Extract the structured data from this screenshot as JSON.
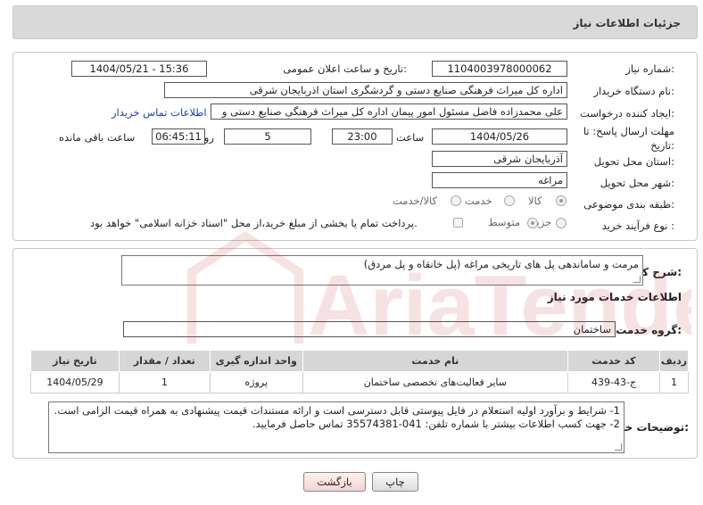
{
  "header": {
    "title": "جزئیات اطلاعات نیاز"
  },
  "form": {
    "need_number_label": "شماره نیاز:",
    "need_number": "1104003978000062",
    "announce_label": "تاریخ و ساعت اعلان عمومی:",
    "announce_value": "1404/05/21 - 15:36",
    "buyer_label": "نام دستگاه خریدار:",
    "buyer_value": "اداره کل میراث فرهنگی  صنایع دستی و گردشگری استان اذربایجان شرقی",
    "creator_label": "ایجاد کننده درخواست:",
    "creator_value": "علی محمدزاده فاضل مسئول امور پیمان اداره کل میراث فرهنگی  صنایع دستی و",
    "contact_link": "اطلاعات تماس خریدار",
    "deadline_label_1": "مهلت ارسال پاسخ: تا",
    "deadline_label_2": "تاریخ:",
    "deadline_date": "1404/05/26",
    "time_label": "ساعت",
    "deadline_time": "23:00",
    "days_value": "5",
    "days_label": "روز و",
    "remaining_time": "06:45:11",
    "remaining_label": "ساعت باقی مانده",
    "province_label": "استان محل تحویل:",
    "province_value": "آذربایجان شرقی",
    "city_label": "شهر محل تحویل:",
    "city_value": "مراغه",
    "category_label": "طبقه بندی موضوعی:",
    "category_options": [
      "کالا",
      "خدمت",
      "کالا/خدمت"
    ],
    "process_label": "نوع فرآیند خرید :",
    "process_options": [
      "جزیی",
      "متوسط"
    ],
    "payment_note": "پرداخت تمام یا بخشی از مبلغ خرید،از محل \"اسناد خزانه اسلامی\" خواهد بود."
  },
  "summary": {
    "label": "شرح کلی نیاز:",
    "value": "مرمت و ساماندهی پل های تاریخی مراغه (پل خانقاه و پل مردق)"
  },
  "services": {
    "section_title": "اطلاعات خدمات مورد نیاز",
    "group_label": "گروه خدمت:",
    "group_value": "ساختمان",
    "columns": [
      "ردیف",
      "کد خدمت",
      "نام خدمت",
      "واحد اندازه گیری",
      "تعداد / مقدار",
      "تاریخ نیاز"
    ],
    "rows": [
      [
        "1",
        "ج-43-439",
        "سایر فعالیت‌های تخصصی ساختمان",
        "پروژه",
        "1",
        "1404/05/29"
      ]
    ]
  },
  "notes": {
    "label": "توضیحات خریدار:",
    "line1": "1- شرایط و برآورد اولیه استعلام در فایل پیوستی قابل دسترسی است و ارائه مستندات قیمت پیشنهادی به همراه قیمت الزامی است.",
    "line2": "2- جهت کسب اطلاعات بیشتر  با شماره تلفن: 041-35574381  تماس حاصل فرمایید."
  },
  "buttons": {
    "print": "چاپ",
    "back": "بازگشت"
  },
  "watermark": {
    "text": "AriaTender.net",
    "color": "#c0272d"
  }
}
